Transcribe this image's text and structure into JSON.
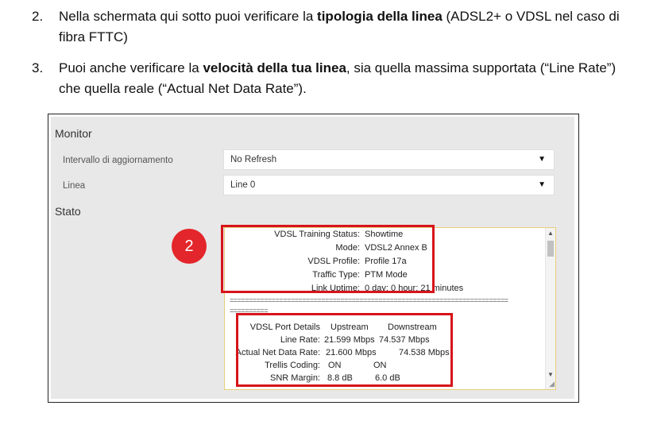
{
  "steps": [
    {
      "num": "2.",
      "before": "Nella schermata qui sotto puoi verificare la ",
      "bold": "tipologia della linea",
      "after": " (ADSL2+ o VDSL nel caso di fibra FTTC)"
    },
    {
      "num": "3.",
      "before": "Puoi anche verificare la ",
      "bold": "velocità della tua linea",
      "after": ", sia quella massima supportata (“Line Rate”) che quella reale (“Actual Net Data Rate”)."
    }
  ],
  "monitor": {
    "title": "Monitor",
    "refresh": {
      "label": "Intervallo di aggiornamento",
      "value": "No Refresh"
    },
    "line": {
      "label": "Linea",
      "value": "Line 0"
    },
    "status_title": "Stato",
    "badge": "2",
    "status_lines": [
      {
        "key": "VDSL Training Status:",
        "val": "Showtime"
      },
      {
        "key": "Mode:",
        "val": "VDSL2 Annex B"
      },
      {
        "key": "VDSL Profile:",
        "val": "Profile 17a"
      },
      {
        "key": "Traffic Type:",
        "val": "PTM Mode"
      },
      {
        "key": "Link Uptime:",
        "val": "0 day: 0 hour: 21 minutes"
      }
    ],
    "separator_long": "=========================================================================",
    "separator_short": "==========",
    "port_header": {
      "label": "VDSL Port Details",
      "up": "Upstream",
      "down": "Downstream"
    },
    "port_rows": [
      {
        "label": "Line Rate:",
        "up": "21.599 Mbps",
        "down": "74.537 Mbps"
      },
      {
        "label": "Actual Net Data Rate:",
        "up": "21.600 Mbps",
        "down": "74.538 Mbps"
      },
      {
        "label": "Trellis Coding:",
        "up": "ON",
        "down": "ON"
      },
      {
        "label": "SNR Margin:",
        "up": "8.8 dB",
        "down": "6.0 dB"
      }
    ]
  }
}
